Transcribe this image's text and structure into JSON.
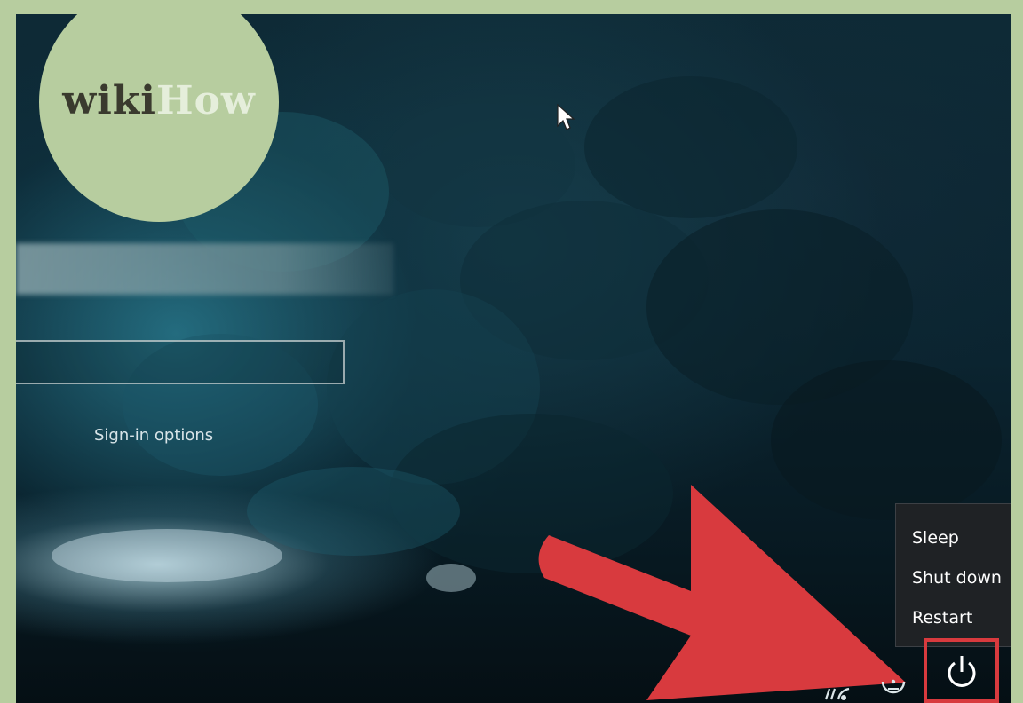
{
  "logo": {
    "wiki": "wiki",
    "how": "How"
  },
  "signin": {
    "options_label": "Sign-in options"
  },
  "power_menu": {
    "items": [
      {
        "label": "Sleep"
      },
      {
        "label": "Shut down"
      },
      {
        "label": "Restart"
      }
    ]
  },
  "icons": {
    "power": "power-icon",
    "network": "network-icon",
    "ease_of_access": "ease-of-access-icon",
    "cursor": "mouse-cursor-icon",
    "arrow": "red-arrow-annotation"
  },
  "colors": {
    "annotation_red": "#d83a3e",
    "logo_green": "#b7cd9f",
    "menu_bg": "#1f2225"
  }
}
